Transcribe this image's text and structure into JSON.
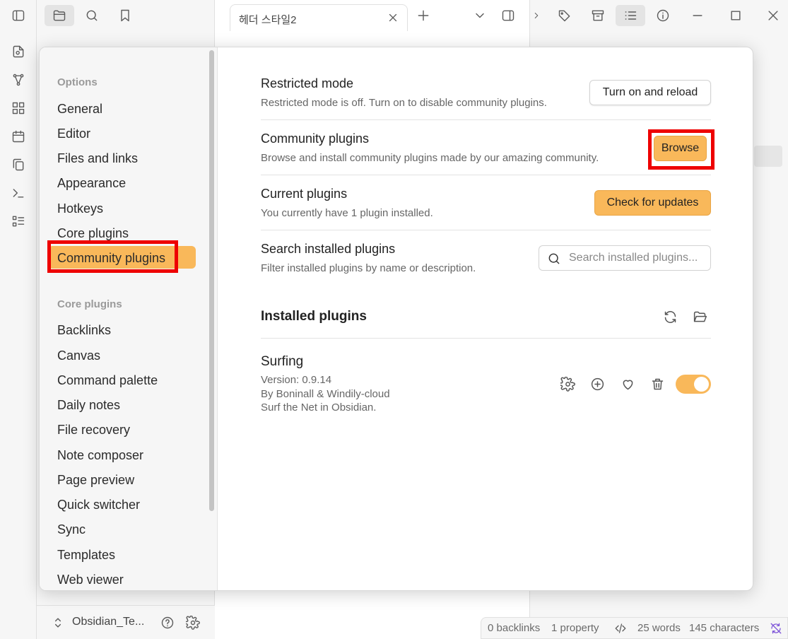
{
  "tab": {
    "title": "헤더 스타일2"
  },
  "vault": {
    "name": "Obsidian_Te..."
  },
  "status": {
    "backlinks": "0 backlinks",
    "properties": "1 property",
    "words": "25 words",
    "characters": "145 characters"
  },
  "settings_sidebar": {
    "options_heading": "Options",
    "options": [
      "General",
      "Editor",
      "Files and links",
      "Appearance",
      "Hotkeys",
      "Core plugins",
      "Community plugins"
    ],
    "active_item": "Community plugins",
    "core_heading": "Core plugins",
    "core_plugins": [
      "Backlinks",
      "Canvas",
      "Command palette",
      "Daily notes",
      "File recovery",
      "Note composer",
      "Page preview",
      "Quick switcher",
      "Sync",
      "Templates",
      "Web viewer"
    ]
  },
  "community": {
    "restricted": {
      "title": "Restricted mode",
      "desc": "Restricted mode is off. Turn on to disable community plugins.",
      "button": "Turn on and reload"
    },
    "browse": {
      "title": "Community plugins",
      "desc": "Browse and install community plugins made by our amazing community.",
      "button": "Browse"
    },
    "current": {
      "title": "Current plugins",
      "desc": "You currently have 1 plugin installed.",
      "button": "Check for updates"
    },
    "search": {
      "title": "Search installed plugins",
      "desc": "Filter installed plugins by name or description.",
      "placeholder": "Search installed plugins..."
    },
    "installed_heading": "Installed plugins",
    "plugins": [
      {
        "name": "Surfing",
        "version": "Version: 0.9.14",
        "author": "By Boninall & Windily-cloud",
        "description": "Surf the Net in Obsidian.",
        "enabled": true
      }
    ]
  },
  "colors": {
    "accent": "#f9b85a",
    "highlight": "#ee0000"
  },
  "icons": [
    "sidebar-toggle-icon",
    "folder-icon",
    "search-icon",
    "bookmark-icon",
    "plus-icon",
    "chevron-down-icon",
    "tag-icon",
    "archive-icon",
    "list-icon",
    "info-icon",
    "minimize-icon",
    "maximize-icon",
    "close-icon",
    "refresh-icon",
    "folder-open-icon",
    "gear-icon",
    "plus-circle-icon",
    "heart-icon",
    "trash-icon"
  ]
}
